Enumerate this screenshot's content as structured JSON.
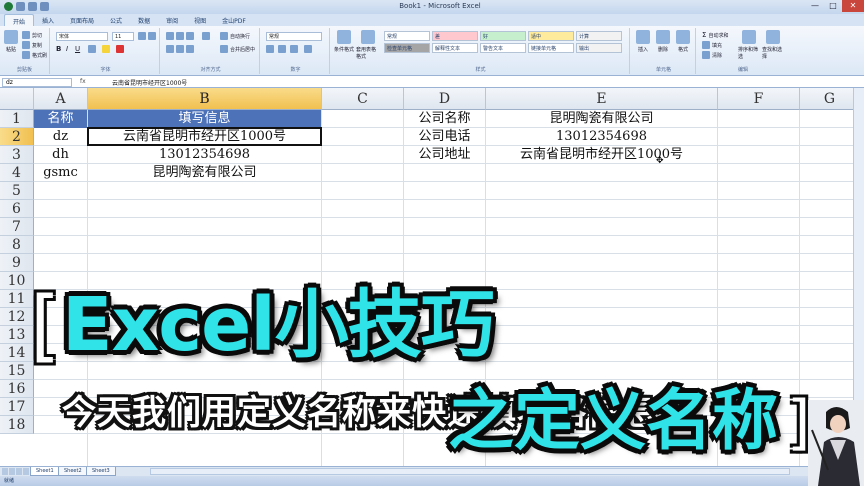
{
  "window": {
    "title": "Book1 - Microsoft Excel",
    "controls": [
      "—",
      "□",
      "✕"
    ]
  },
  "ribbon_tabs": [
    "开始",
    "插入",
    "页面布局",
    "公式",
    "数据",
    "审阅",
    "视图",
    "金山PDF"
  ],
  "ribbon": {
    "clipboard": {
      "label": "剪贴板",
      "paste": "粘贴",
      "cut": "剪切",
      "copy": "复制",
      "format_painter": "格式刷"
    },
    "font": {
      "label": "字体",
      "font_name": "宋体",
      "font_size": "11"
    },
    "alignment": {
      "label": "对齐方式",
      "wrap": "自动换行",
      "merge": "合并后居中"
    },
    "number": {
      "label": "数字",
      "format": "常规"
    },
    "styles": {
      "label": "样式",
      "conditional": "条件格式",
      "table_format": "套用表格格式",
      "cell_styles": [
        "常规",
        "差",
        "好",
        "适中",
        "计算",
        "检查单元格",
        "解释性文本",
        "警告文本",
        "链接单元格",
        "输出"
      ],
      "cell_style_colors": [
        "#ffffff",
        "#ffc7ce",
        "#c6efce",
        "#ffeb9c",
        "#f2f2f2",
        "#a5a5a5",
        "#ffffff",
        "#ffffff",
        "#ffffff",
        "#f2f2f2"
      ]
    },
    "cells": {
      "label": "单元格",
      "insert": "插入",
      "delete": "删除",
      "format": "格式"
    },
    "editing": {
      "label": "编辑",
      "autosum": "自动求和",
      "fill": "填充",
      "clear": "清除",
      "sort": "排序和筛选",
      "find": "查找和选择"
    }
  },
  "formula_bar": {
    "name_box": "dz",
    "fx": "fx",
    "content": "云南省昆明市经开区1000号"
  },
  "columns": [
    "A",
    "B",
    "C",
    "D",
    "E",
    "F",
    "G"
  ],
  "rows": [
    "1",
    "2",
    "3",
    "4",
    "5",
    "6",
    "7",
    "8",
    "9",
    "10",
    "11",
    "12",
    "13",
    "14",
    "15",
    "16",
    "17",
    "18"
  ],
  "cells": {
    "A1": "名称",
    "B1": "填写信息",
    "A2": "dz",
    "B2": "云南省昆明市经开区1000号",
    "A3": "dh",
    "B3": "13012354698",
    "A4": "gsmc",
    "B4": "昆明陶瓷有限公司",
    "D1": "公司名称",
    "E1": "昆明陶瓷有限公司",
    "D2": "公司电话",
    "E2": "13012354698",
    "D3": "公司地址",
    "E3": "云南省昆明市经开区1000号"
  },
  "sheets": [
    "Sheet1",
    "Sheet2",
    "Sheet3"
  ],
  "status": "就绪",
  "overlay": {
    "bracket_open": "[",
    "title": "Excel小技巧",
    "subtitle": "今天我们用定义名称来快速填表格信息",
    "highlight": "之定义名称",
    "bracket_close": "]",
    "title_color": "#2fe3e8"
  }
}
